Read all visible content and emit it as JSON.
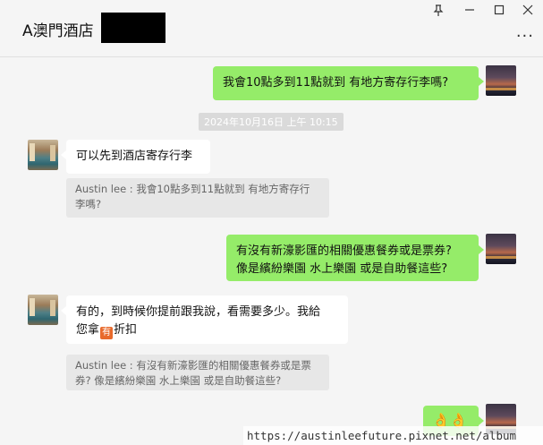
{
  "window": {
    "title": "A澳門酒店",
    "pin_icon": "pin-icon",
    "minimize_icon": "minimize-icon",
    "maximize_icon": "maximize-icon",
    "close_icon": "close-icon",
    "more_icon": "more-icon"
  },
  "messages": [
    {
      "side": "right",
      "type": "text",
      "text": "我會10點多到11點就到  有地方寄存行李嗎?"
    },
    {
      "type": "timestamp",
      "text": "2024年10月16日 上午 10:15"
    },
    {
      "side": "left",
      "type": "text",
      "text": "可以先到酒店寄存行李",
      "quote": "Austin lee : 我會10點多到11點就到  有地方寄存行\n李嗎?"
    },
    {
      "side": "right",
      "type": "text",
      "line1": "有沒有新濠影匯的相關優惠餐券或是票券?",
      "line2": "像是繽紛樂園 水上樂園   或是自助餐這些?"
    },
    {
      "side": "left",
      "type": "text",
      "line1": "有的，到時候你提前跟我說，看需要多少。我給",
      "line2_pre": "您拿",
      "line2_emoji": "有",
      "line2_post": "折扣",
      "quote_line1": "Austin lee : 有沒有新濠影匯的相關優惠餐券或是票",
      "quote_line2": "券?  像是繽紛樂園 水上樂園   或是自助餐這些?"
    },
    {
      "side": "right",
      "type": "emoji",
      "text": "👌👌"
    }
  ],
  "watermark": "https://austinleefuture.pixnet.net/album",
  "colors": {
    "green_bubble": "#95ec69",
    "white_bubble": "#ffffff",
    "background": "#f5f5f5",
    "quote_bg": "#e7e7e7"
  }
}
